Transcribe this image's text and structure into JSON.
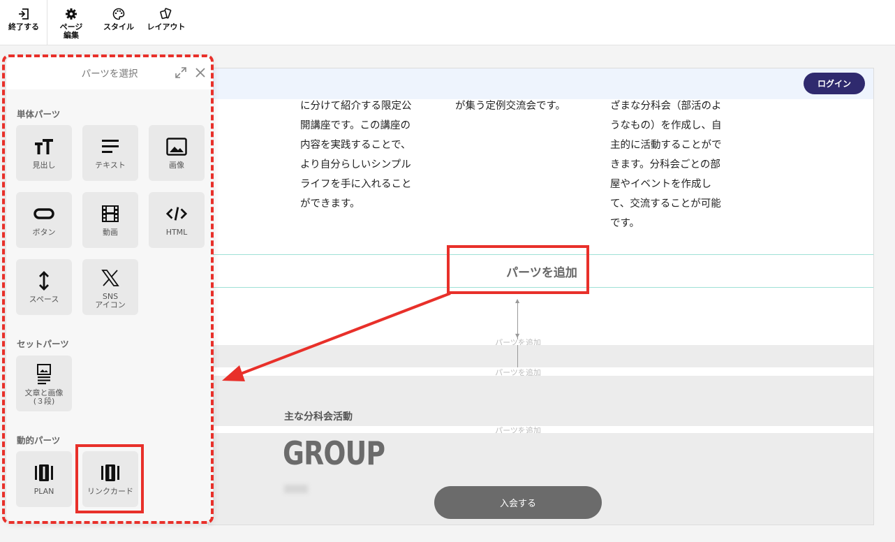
{
  "toolbar": {
    "exit_label": "終了する",
    "page_edit_label": "ページ\n編集",
    "style_label": "スタイル",
    "layout_label": "レイアウト"
  },
  "site": {
    "login_label": "ログイン",
    "col1_text": "に分けて紹介する限定公\n開講座です。この講座の\n内容を実践することで、\nより自分らしいシンプル\nライフを手に入れること\nができます。",
    "col2_text": "が集う定例交流会です。",
    "col3_text": "ざまな分科会（部活のよ\nうなもの）を作成し、自\n主的に活動することがで\nきます。分科会ごとの部\n屋やイベントを作成し\nて、交流することが可能\nです。",
    "add_parts_label": "パーツを追加",
    "add_parts_small": "パーツを追加",
    "section_label": "主な分科会活動",
    "group_title": "GROUP",
    "join_label": "入会する"
  },
  "panel": {
    "title": "パーツを選択",
    "groups": {
      "single": "単体パーツ",
      "set": "セットパーツ",
      "dynamic": "動的パーツ"
    },
    "tiles": {
      "heading": "見出し",
      "text": "テキスト",
      "image": "画像",
      "button": "ボタン",
      "video": "動画",
      "html": "HTML",
      "space": "スペース",
      "sns": "SNS\nアイコン",
      "text_image": "文章と画像\n(３段)",
      "plan": "PLAN",
      "link_card": "リンクカード"
    }
  },
  "colors": {
    "annotation_red": "#e8302a",
    "login_bg": "#2f2a6e",
    "add_row_border": "#9fe0d6"
  }
}
